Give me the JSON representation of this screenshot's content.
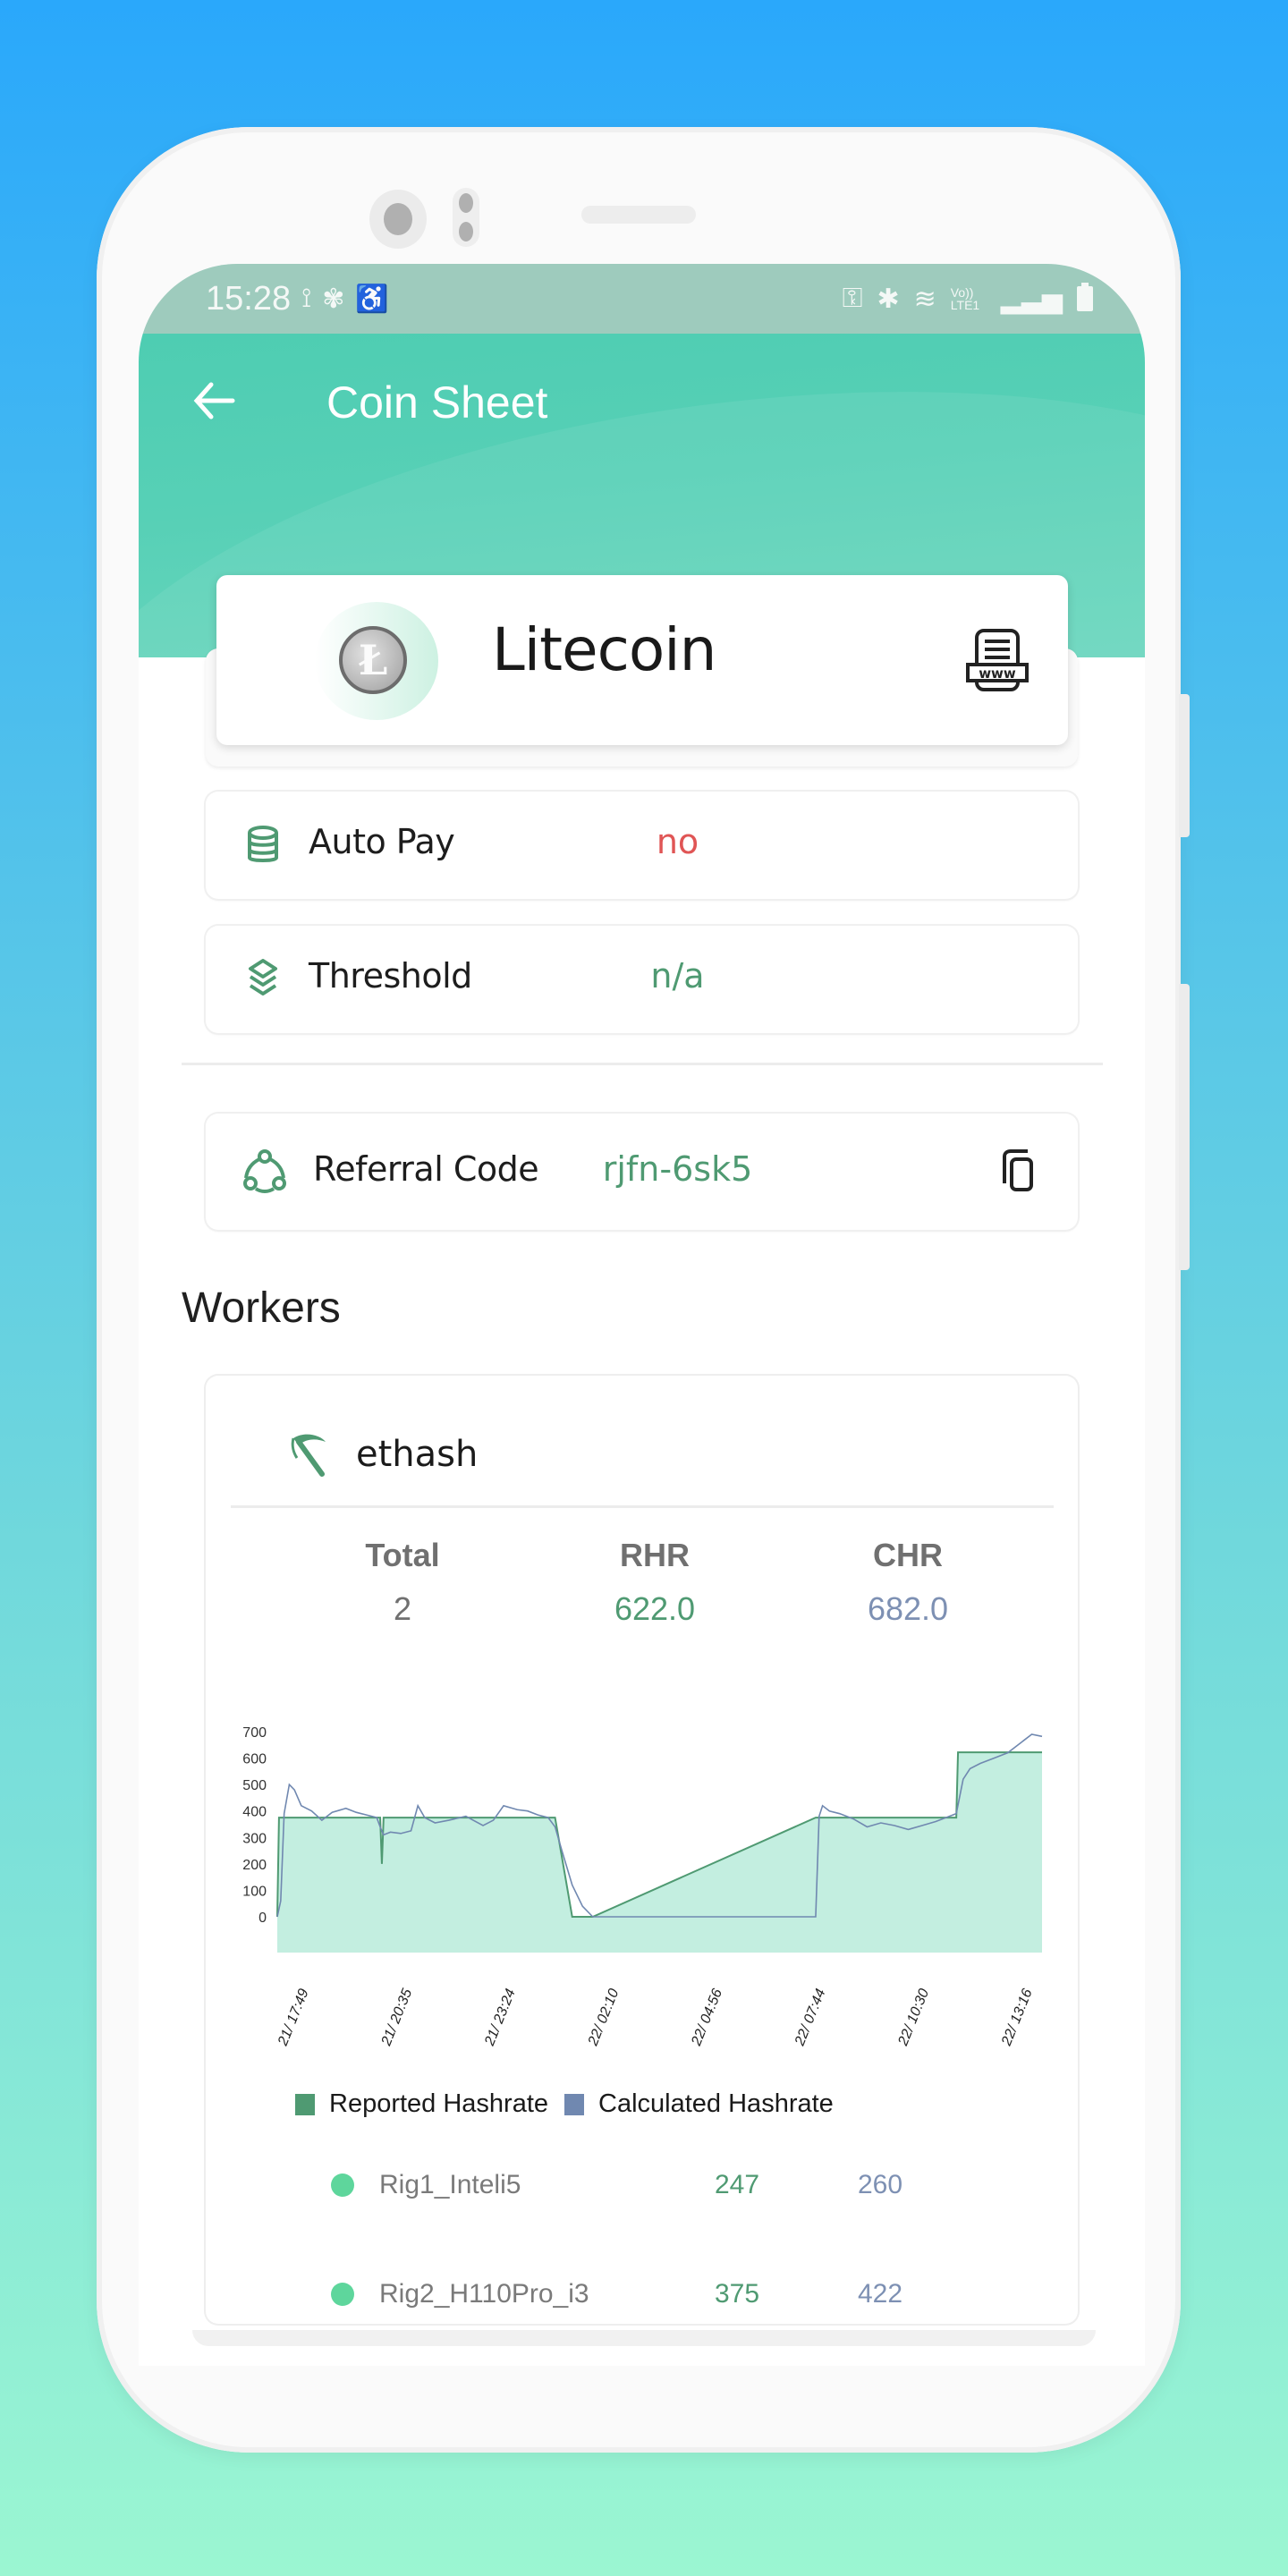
{
  "status_bar": {
    "time": "15:28",
    "left_icons": [
      "location-check-icon",
      "fan-icon",
      "accessibility-icon"
    ],
    "right_icons": [
      "vpn-key-icon",
      "bluetooth-icon",
      "wifi-icon",
      "volte-icon",
      "signal-icon",
      "battery-icon"
    ],
    "volte_label": "Vo)) LTE1"
  },
  "header": {
    "title": "Coin Sheet",
    "back_icon": "arrow-left-icon"
  },
  "coin": {
    "name": "Litecoin",
    "symbol_glyph": "Ł",
    "website_icon": "www-document-icon"
  },
  "info": [
    {
      "label": "Auto Pay",
      "value": "no",
      "value_color": "#e05555",
      "icon": "database-icon"
    },
    {
      "label": "Threshold",
      "value": "n/a",
      "value_color": "#4f9a72",
      "icon": "layers-icon"
    }
  ],
  "referral": {
    "label": "Referral Code",
    "value": "rjfn-6sk5",
    "value_color": "#4f9a72",
    "icon": "community-icon",
    "copy_icon": "copy-icon"
  },
  "workers": {
    "title": "Workers",
    "algorithm": "ethash",
    "stats": [
      {
        "label": "Total",
        "value": "2",
        "color": "#707070"
      },
      {
        "label": "RHR",
        "value": "622.0",
        "color": "#4f9a72"
      },
      {
        "label": "CHR",
        "value": "682.0",
        "color": "#7d90b3"
      }
    ],
    "rigs": [
      {
        "name": "Rig1_Inteli5",
        "rhr": "247",
        "chr": "260",
        "status_color": "#5ed69c"
      },
      {
        "name": "Rig2_H110Pro_i3",
        "rhr": "375",
        "chr": "422",
        "status_color": "#5ed69c"
      }
    ]
  },
  "chart_data": {
    "type": "area",
    "title": "",
    "xlabel": "",
    "ylabel": "",
    "ylim": [
      0,
      700
    ],
    "yticks": [
      0,
      100,
      200,
      300,
      400,
      500,
      600,
      700
    ],
    "x_tick_labels": [
      "21/ 17:49",
      "21/ 20:35",
      "21/ 23:24",
      "22/ 02:10",
      "22/ 04:56",
      "22/ 07:44",
      "22/ 10:30",
      "22/ 13:16"
    ],
    "x_range_hours": [
      0,
      22.3
    ],
    "grid": false,
    "legend": "bottom-left",
    "series": [
      {
        "name": "Reported Hashrate",
        "color": "#4f9a72",
        "fill": "#c3eee0",
        "x_hours": [
          0,
          0.05,
          0.1,
          3.0,
          3.05,
          3.1,
          3.15,
          8.1,
          8.6,
          8.7,
          9.2,
          15.7,
          15.75,
          19.8,
          19.85,
          22.3
        ],
        "values": [
          0,
          375,
          375,
          375,
          200,
          375,
          375,
          375,
          0,
          0,
          0,
          375,
          375,
          375,
          622,
          622
        ]
      },
      {
        "name": "Calculated Hashrate",
        "color": "#7088b0",
        "x_hours": [
          0,
          0.1,
          0.2,
          0.35,
          0.5,
          0.7,
          1.0,
          1.3,
          1.6,
          2.0,
          2.3,
          2.6,
          2.9,
          3.0,
          3.1,
          3.3,
          3.6,
          3.9,
          4.1,
          4.3,
          4.6,
          5.0,
          5.5,
          6.0,
          6.3,
          6.6,
          7.0,
          7.3,
          7.6,
          7.9,
          8.1,
          8.3,
          8.6,
          8.9,
          9.2,
          15.7,
          15.8,
          15.9,
          16.1,
          16.4,
          16.8,
          17.2,
          17.6,
          18.0,
          18.4,
          18.8,
          19.2,
          19.6,
          19.8,
          20.0,
          20.2,
          20.5,
          20.9,
          21.3,
          21.7,
          22.0,
          22.3
        ],
        "values": [
          0,
          60,
          390,
          500,
          480,
          420,
          400,
          365,
          395,
          410,
          395,
          385,
          375,
          340,
          310,
          320,
          315,
          325,
          420,
          375,
          355,
          365,
          380,
          345,
          365,
          420,
          405,
          400,
          385,
          375,
          340,
          250,
          120,
          40,
          0,
          0,
          380,
          420,
          400,
          390,
          370,
          340,
          355,
          345,
          330,
          345,
          360,
          380,
          390,
          520,
          560,
          580,
          600,
          620,
          660,
          690,
          682
        ]
      }
    ]
  }
}
